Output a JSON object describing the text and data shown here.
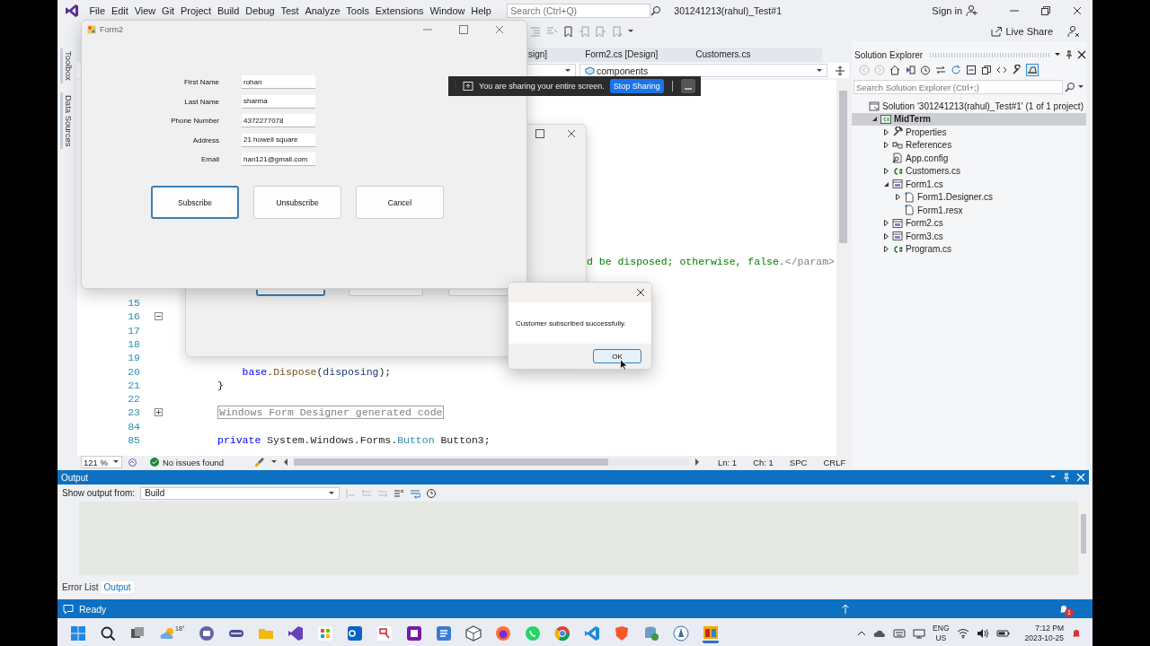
{
  "menubar": {
    "items": [
      "File",
      "Edit",
      "View",
      "Git",
      "Project",
      "Build",
      "Debug",
      "Test",
      "Analyze",
      "Tools",
      "Extensions",
      "Window",
      "Help"
    ],
    "search": {
      "placeholder": "Search (Ctrl+Q)"
    },
    "title": "301241213(rahul)_Test#1",
    "sign_in": "Sign in"
  },
  "toolbar": {
    "live_share": "Live Share"
  },
  "side_rail": {
    "tabs": [
      "Toolbox",
      "Data Sources"
    ]
  },
  "editor": {
    "tabs": [
      {
        "label": "sign]",
        "selected": false
      },
      {
        "label": "Form2.cs [Design]",
        "selected": false
      },
      {
        "label": "Customers.cs",
        "selected": false
      }
    ],
    "member": "components",
    "lines": [
      {
        "kind": "clipped",
        "tokens": [
          {
            "kind": "comment",
            "text": "d be disposed; otherwise, false."
          },
          {
            "kind": "doc_tag",
            "text": "</param>"
          }
        ]
      },
      {
        "number": "15"
      },
      {
        "number": "16",
        "expanded": true
      },
      {
        "number": "17"
      },
      {
        "number": "18"
      },
      {
        "number": "19"
      },
      {
        "number": "20",
        "tokens": [
          {
            "kind": "keyword",
            "text": "    base"
          },
          {
            "kind": "plain",
            "text": "."
          },
          {
            "kind": "method",
            "text": "Dispose"
          },
          {
            "kind": "plain",
            "text": "("
          },
          {
            "kind": "param",
            "text": "disposing"
          },
          {
            "kind": "plain",
            "text": ");"
          }
        ]
      },
      {
        "number": "21",
        "tokens": [
          {
            "kind": "plain",
            "text": "}"
          }
        ]
      },
      {
        "number": "22"
      },
      {
        "number": "23",
        "expanded": false,
        "tokens": [
          {
            "kind": "region",
            "text": "Windows Form Designer generated code"
          }
        ]
      },
      {
        "number": "84"
      },
      {
        "number": "85",
        "tokens": [
          {
            "kind": "keyword",
            "text": "private"
          },
          {
            "kind": "plain",
            "text": " System.Windows.Forms."
          },
          {
            "kind": "type",
            "text": "Button"
          },
          {
            "kind": "plain",
            "text": " Button3;"
          }
        ]
      }
    ],
    "status": {
      "zoom": "121 %",
      "issues": "No issues found",
      "line": "Ln: 1",
      "column": "Ch: 1",
      "whitespace": "SPC",
      "line_ending": "CRLF"
    }
  },
  "solution_explorer": {
    "title": "Solution Explorer",
    "search": {
      "placeholder": "Search Solution Explorer (Ctrl+;)"
    },
    "tree": [
      {
        "label": "Solution '301241213(rahul)_Test#1' (1 of 1 project)",
        "kind": "solution",
        "selected": false,
        "children": [
          {
            "label": "MidTerm",
            "kind": "project",
            "selected": true,
            "expanded": true,
            "children": [
              {
                "label": "Properties",
                "kind": "properties",
                "selected": false,
                "expanded": false
              },
              {
                "label": "References",
                "kind": "references",
                "selected": false,
                "expanded": false
              },
              {
                "label": "App.config",
                "kind": "config",
                "selected": false
              },
              {
                "label": "Customers.cs",
                "kind": "csharp",
                "selected": false,
                "expanded": false
              },
              {
                "label": "Form1.cs",
                "kind": "form",
                "selected": false,
                "expanded": true,
                "children": [
                  {
                    "label": "Form1.Designer.cs",
                    "kind": "file",
                    "selected": false,
                    "expanded": false
                  },
                  {
                    "label": "Form1.resx",
                    "kind": "file",
                    "selected": false
                  }
                ]
              },
              {
                "label": "Form2.cs",
                "kind": "form",
                "selected": false,
                "expanded": false
              },
              {
                "label": "Form3.cs",
                "kind": "form",
                "selected": false,
                "expanded": false
              },
              {
                "label": "Program.cs",
                "kind": "csharp",
                "selected": false,
                "expanded": false
              }
            ]
          }
        ]
      }
    ]
  },
  "output": {
    "title": "Output",
    "source_label": "Show output from:",
    "source": "Build",
    "tabs": [
      {
        "label": "Error List",
        "selected": false
      },
      {
        "label": "Output",
        "selected": true
      }
    ]
  },
  "status_bar": {
    "text": "Ready",
    "notifications": "1"
  },
  "taskbar": {
    "weather": "18°",
    "language": "ENG",
    "region": "US",
    "time": "7:12 PM",
    "date": "2023-10-25"
  },
  "windows": {
    "back_form": {
      "buttons": [
        {
          "focused": true
        },
        {
          "focused": false
        },
        {
          "focused": false
        }
      ]
    },
    "form2": {
      "title": "Form2",
      "fields": [
        {
          "label": "First Name",
          "value": "rohan"
        },
        {
          "label": "Last Name",
          "value": "sharma"
        },
        {
          "label": "Phone Number",
          "value": "4372277078"
        },
        {
          "label": "Address",
          "value": "21 howell square"
        },
        {
          "label": "Email",
          "value": "han121@gmail.com"
        }
      ],
      "buttons": [
        {
          "label": "Subscribe",
          "focused": true
        },
        {
          "label": "Unsubscribe",
          "focused": false
        },
        {
          "label": "Cancel",
          "focused": false
        }
      ]
    },
    "share_bar": {
      "message": "You are sharing your entire screen.",
      "action": "Stop Sharing"
    },
    "message_box": {
      "message": "Customer subscribed successfully.",
      "button": "OK",
      "focused": true
    }
  }
}
